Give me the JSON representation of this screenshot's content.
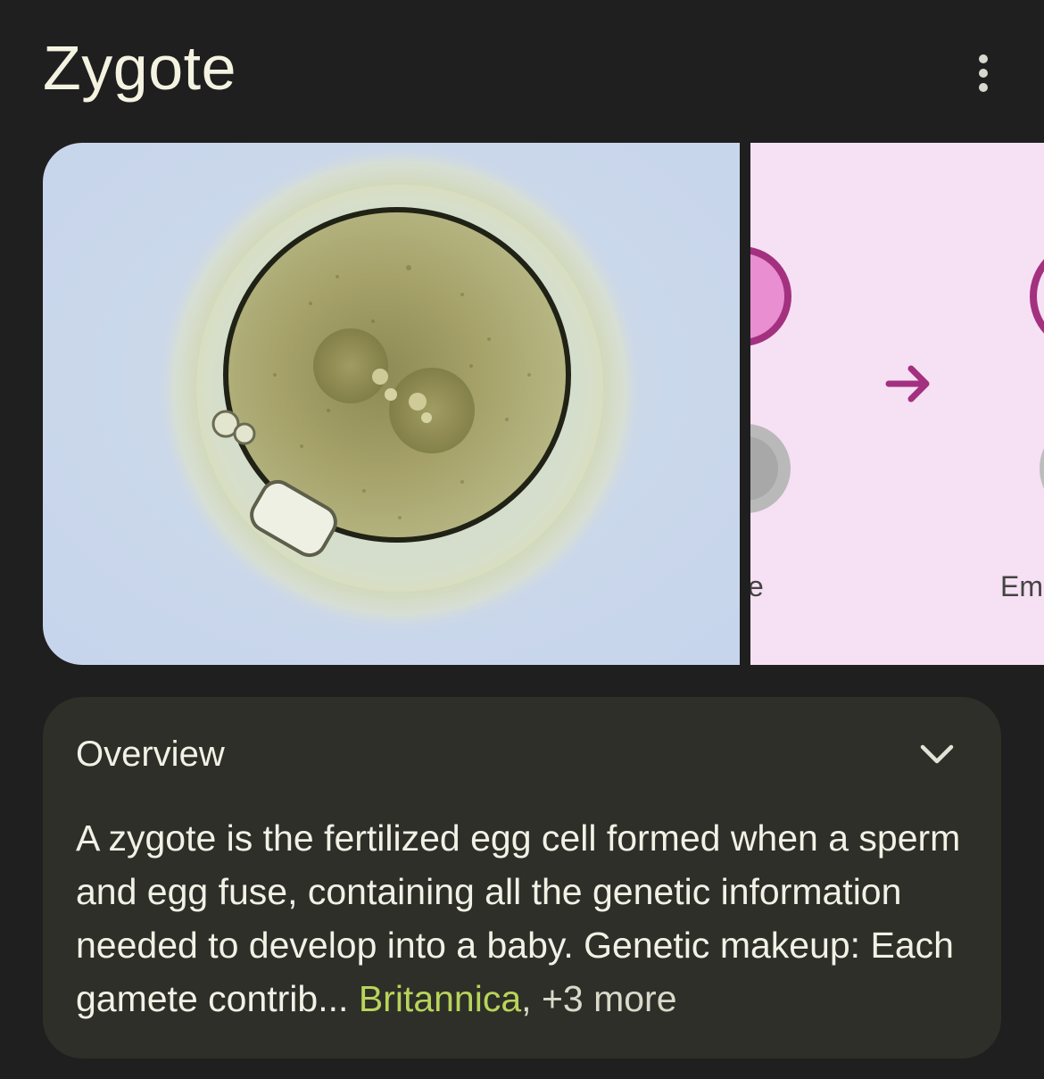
{
  "header": {
    "title": "Zygote",
    "menu_icon": "more-vert-icon"
  },
  "images": [
    {
      "name": "zygote-micrograph"
    },
    {
      "name": "fertilization-diagram",
      "labels": [
        "e",
        "Em"
      ]
    }
  ],
  "overview": {
    "title": "Overview",
    "expand_icon": "chevron-down-icon",
    "text": "A zygote is the fertilized egg cell formed when a sperm and egg fuse, containing all the genetic information needed to develop into a baby. Genetic makeup: Each gamete contrib",
    "ellipsis": "...",
    "source": "Britannica",
    "separator": ",",
    "more": "+3 more"
  },
  "colors": {
    "background": "#1f1f1f",
    "card": "#2e2f28",
    "link_accent": "#b8d45a",
    "diagram_bg": "#f6e0f3",
    "diagram_accent": "#a3317f"
  }
}
